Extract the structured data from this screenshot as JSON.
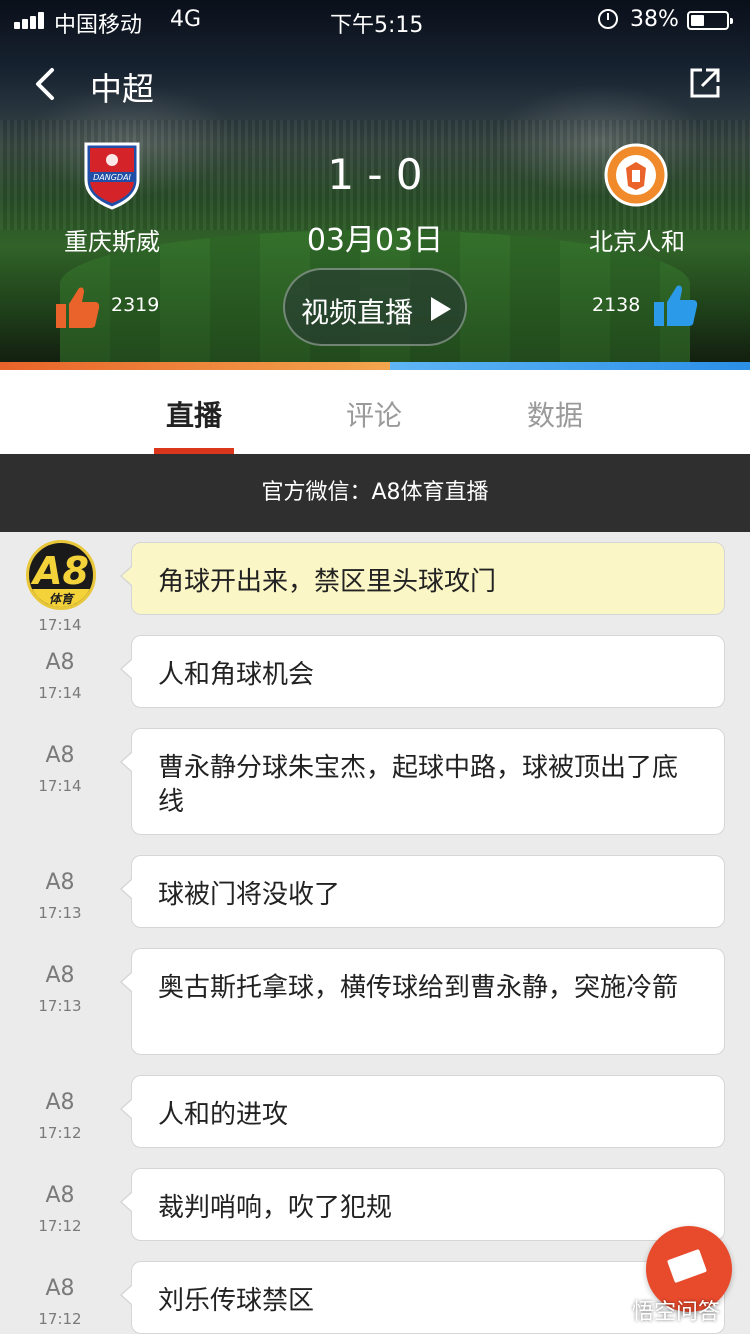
{
  "status_bar": {
    "carrier": "中国移动",
    "network": "4G",
    "time": "下午5:15",
    "battery_pct": "38%",
    "battery_level": 0.38,
    "alarm_icon": "alarm-clock-icon"
  },
  "header": {
    "back_icon": "chevron-left-icon",
    "league": "中超",
    "share_icon": "share-external-icon"
  },
  "match": {
    "home": {
      "name": "重庆斯威",
      "logo_icon": "shield-crest-icon",
      "logo_text": "DANGDAI",
      "likes": "2319",
      "color": "#e9632a"
    },
    "away": {
      "name": "北京人和",
      "logo_icon": "round-crest-icon",
      "likes": "2138",
      "color": "#2b8fe8"
    },
    "score": "1 - 0",
    "date": "03月03日",
    "live_button": "视频直播",
    "like_share_home": 0.52
  },
  "tabs": [
    {
      "label": "直播",
      "active": true
    },
    {
      "label": "评论",
      "active": false
    },
    {
      "label": "数据",
      "active": false
    }
  ],
  "notice": "官方微信：A8体育直播",
  "feed": [
    {
      "author": "A8",
      "avatar_text": "A8",
      "avatar_sub": "体育",
      "time": "17:14",
      "text": "角球开出来，禁区里头球攻门",
      "highlight": true
    },
    {
      "author": "A8",
      "time": "17:14",
      "text": "人和角球机会",
      "highlight": false
    },
    {
      "author": "A8",
      "time": "17:14",
      "text": "曹永静分球朱宝杰，起球中路，球被顶出了底线",
      "highlight": false
    },
    {
      "author": "A8",
      "time": "17:13",
      "text": "球被门将没收了",
      "highlight": false
    },
    {
      "author": "A8",
      "time": "17:13",
      "text": "奥古斯托拿球，横传球给到曹永静，突施冷箭",
      "highlight": false
    },
    {
      "author": "A8",
      "time": "17:12",
      "text": "人和的进攻",
      "highlight": false
    },
    {
      "author": "A8",
      "time": "17:12",
      "text": "裁判哨响，吹了犯规",
      "highlight": false
    },
    {
      "author": "A8",
      "time": "17:12",
      "text": "刘乐传球禁区",
      "highlight": false
    }
  ],
  "fab_icon": "edit-pencil-icon",
  "watermark": "悟空问答",
  "colors": {
    "accent": "#d9361c",
    "highlight_bubble": "#fbf6c6",
    "notice_bg": "#2f2f2f"
  }
}
